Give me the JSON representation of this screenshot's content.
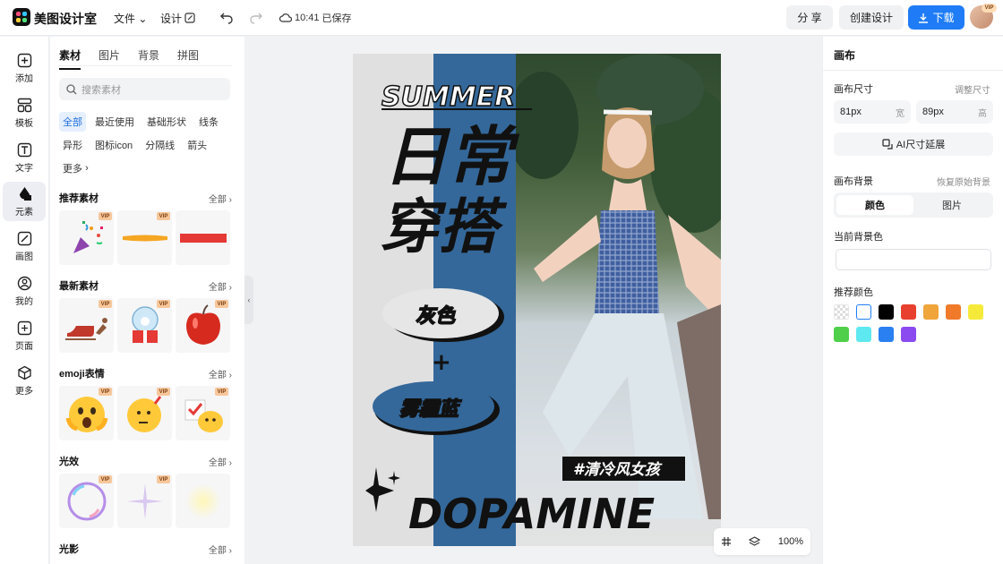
{
  "app": {
    "name": "美图设计室"
  },
  "menu": {
    "file": "文件",
    "design": "设计"
  },
  "status": {
    "save_time": "10:41",
    "save_text": "已保存"
  },
  "actions": {
    "share": "分 享",
    "create": "创建设计",
    "download": "下载"
  },
  "user": {
    "badge": "VIP"
  },
  "rail": [
    {
      "label": "添加",
      "icon": "plus-square-icon"
    },
    {
      "label": "模板",
      "icon": "template-icon"
    },
    {
      "label": "文字",
      "icon": "text-icon"
    },
    {
      "label": "元素",
      "icon": "shapes-icon"
    },
    {
      "label": "画图",
      "icon": "draw-icon"
    },
    {
      "label": "我的",
      "icon": "user-icon"
    },
    {
      "label": "页面",
      "icon": "page-add-icon"
    },
    {
      "label": "更多",
      "icon": "cube-icon"
    }
  ],
  "panel": {
    "tabs": [
      "素材",
      "图片",
      "背景",
      "拼图"
    ],
    "search_placeholder": "搜索素材",
    "chips": [
      "全部",
      "最近使用",
      "基础形状",
      "线条",
      "异形",
      "图标icon",
      "分隔线",
      "箭头",
      "更多"
    ],
    "all_label": "全部",
    "vip_label": "VIP",
    "sections": [
      "推荐素材",
      "最新素材",
      "emoji表情",
      "光效",
      "光影"
    ]
  },
  "zoom": {
    "level": "100%"
  },
  "right": {
    "title": "画布",
    "size_label": "画布尺寸",
    "adjust_link": "调整尺寸",
    "width_value": "81px",
    "width_unit": "宽",
    "height_value": "89px",
    "height_unit": "高",
    "ai_extend": "AI尺寸延展",
    "bg_label": "画布背景",
    "restore_link": "恢复原始背景",
    "seg_color": "颜色",
    "seg_image": "图片",
    "current_color_label": "当前背景色",
    "recommended_label": "推荐颜色",
    "swatches": [
      "transparent",
      "#ffffff",
      "#000000",
      "#e8402f",
      "#f0a53a",
      "#f07a2a",
      "#f5ea3a",
      "#4fcf4a",
      "#5ee8f0",
      "#2a80f0",
      "#8a4af0"
    ]
  }
}
